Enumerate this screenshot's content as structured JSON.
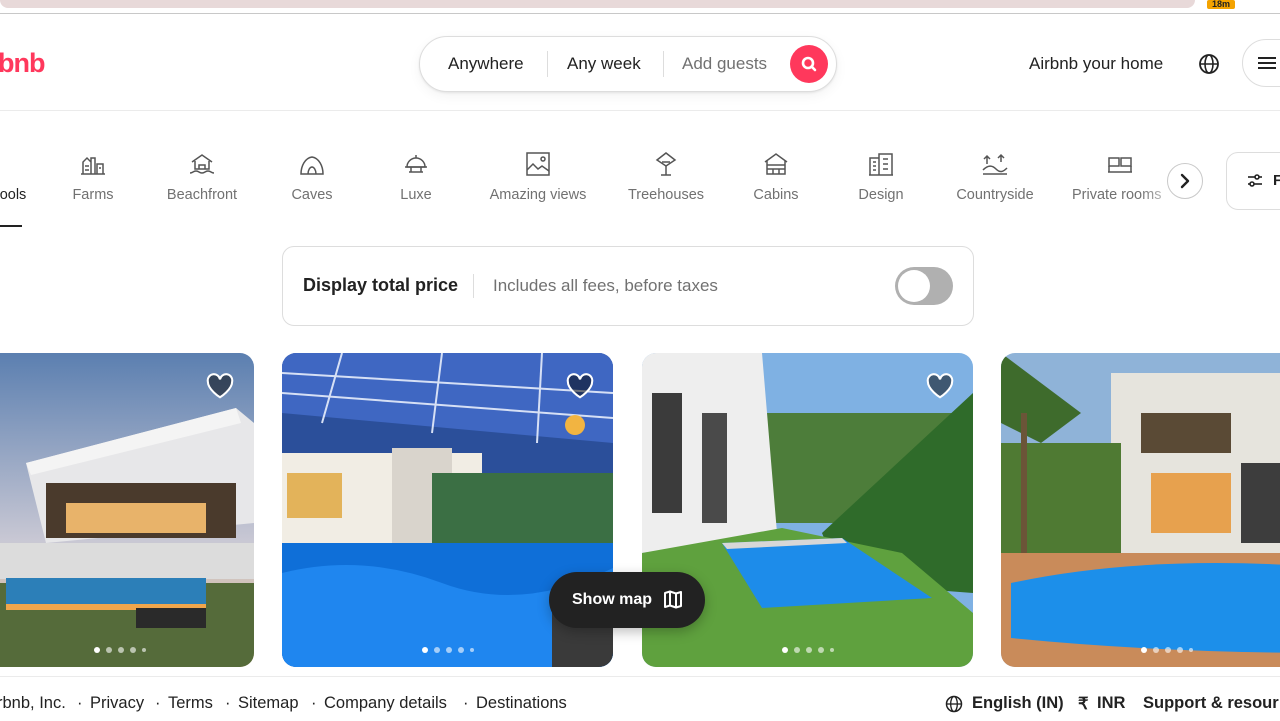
{
  "browser": {
    "badge": "18m"
  },
  "header": {
    "logo": "bnb",
    "search": {
      "anywhere": "Anywhere",
      "any_week": "Any week",
      "guests": "Add guests"
    },
    "host_link": "Airbnb your home"
  },
  "categories": {
    "items": [
      {
        "label": "ools",
        "icon": "pools-icon"
      },
      {
        "label": "Farms",
        "icon": "farm-icon"
      },
      {
        "label": "Beachfront",
        "icon": "beach-icon"
      },
      {
        "label": "Caves",
        "icon": "cave-icon"
      },
      {
        "label": "Luxe",
        "icon": "luxe-icon"
      },
      {
        "label": "Amazing views",
        "icon": "views-icon"
      },
      {
        "label": "Treehouses",
        "icon": "treehouse-icon"
      },
      {
        "label": "Cabins",
        "icon": "cabin-icon"
      },
      {
        "label": "Design",
        "icon": "design-icon"
      },
      {
        "label": "Countryside",
        "icon": "countryside-icon"
      },
      {
        "label": "Private rooms",
        "icon": "private-room-icon"
      }
    ],
    "filters_label": "F"
  },
  "price_toggle": {
    "title": "Display total price",
    "subtitle": "Includes all fees, before taxes",
    "enabled": false
  },
  "show_map": {
    "label": "Show map"
  },
  "footer": {
    "company": "rbnb, Inc.",
    "links": [
      "Privacy",
      "Terms",
      "Sitemap",
      "Company details",
      "Destinations"
    ],
    "language": "English (IN)",
    "currency_symbol": "₹",
    "currency": "INR",
    "support": "Support & resour"
  },
  "colors": {
    "brand": "#ff385c",
    "text": "#222222",
    "muted": "#717171"
  }
}
